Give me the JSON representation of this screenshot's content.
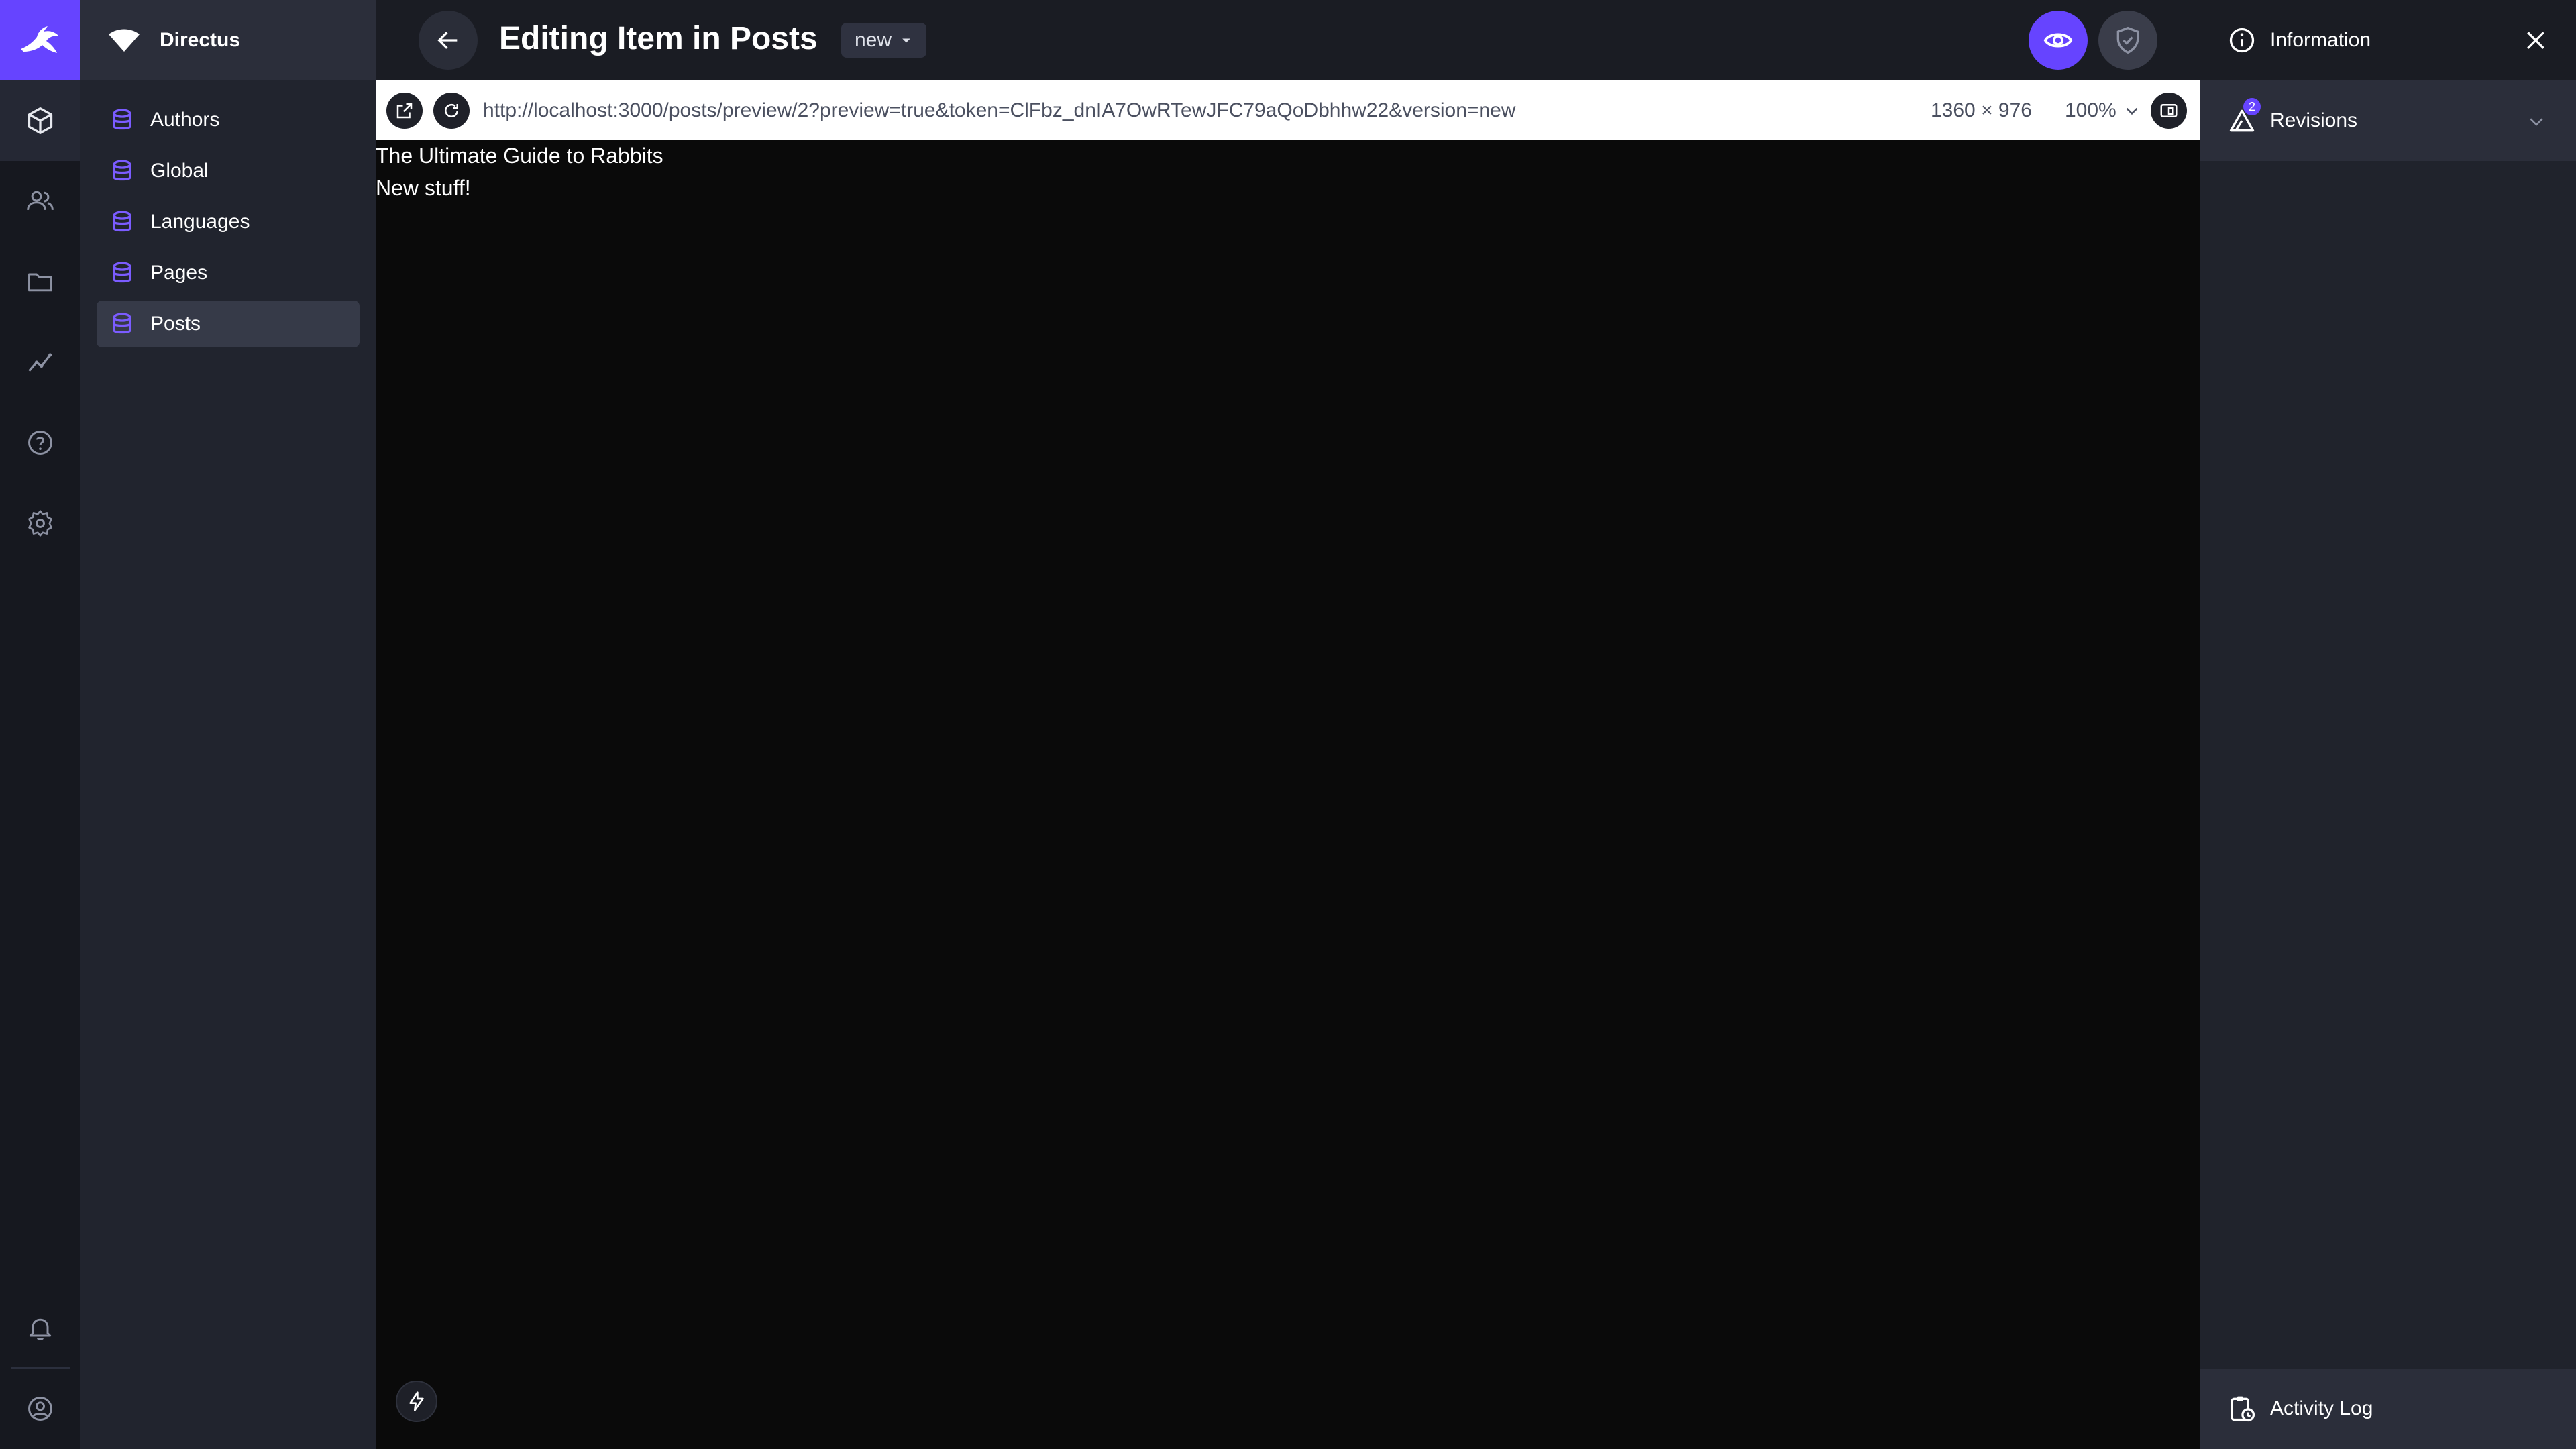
{
  "nav": {
    "project_name": "Directus",
    "collections": [
      {
        "label": "Authors"
      },
      {
        "label": "Global"
      },
      {
        "label": "Languages"
      },
      {
        "label": "Pages"
      },
      {
        "label": "Posts"
      }
    ]
  },
  "header": {
    "title": "Editing Item in Posts",
    "version_label": "new"
  },
  "preview": {
    "url": "http://localhost:3000/posts/preview/2?preview=true&token=ClFbz_dnIA7OwRTewJFC79aQoDbhhw22&version=new",
    "dimensions": "1360 × 976",
    "zoom": "100%",
    "content_title": "The Ultimate Guide to Rabbits",
    "content_body": "New stuff!"
  },
  "sidebar": {
    "information_label": "Information",
    "revisions_label": "Revisions",
    "revisions_count": "2",
    "activity_label": "Activity Log"
  },
  "colors": {
    "accent": "#6644ff",
    "background": "#0c0d11"
  }
}
